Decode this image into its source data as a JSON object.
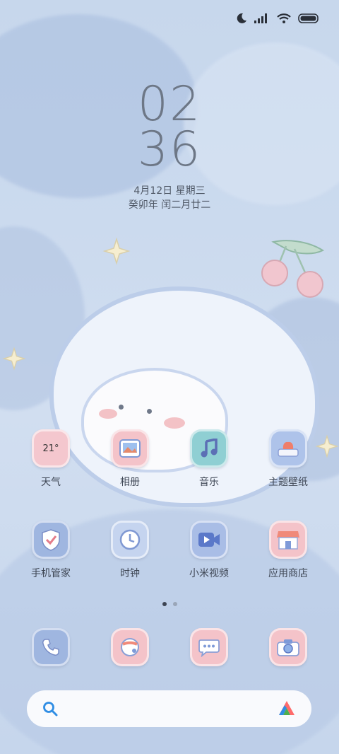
{
  "clock": {
    "hours": "02",
    "minutes": "36"
  },
  "date": {
    "line1": "4月12日 星期三",
    "line2": "癸卯年 闰二月廿二"
  },
  "status_icons": [
    "moon-icon",
    "signal-icon",
    "wifi-icon",
    "battery-icon"
  ],
  "apps_row1": [
    {
      "label": "天气",
      "icon": "weather-icon",
      "temp": "21°",
      "color": "#f4c7ce"
    },
    {
      "label": "相册",
      "icon": "gallery-icon",
      "color": "#f4c3c9"
    },
    {
      "label": "音乐",
      "icon": "music-icon",
      "color": "#8fcfd3"
    },
    {
      "label": "主题壁纸",
      "icon": "theme-icon",
      "color": "#aec3ea"
    }
  ],
  "apps_row2": [
    {
      "label": "手机管家",
      "icon": "shield-icon",
      "color": "#9fb6e0"
    },
    {
      "label": "时钟",
      "icon": "clock-icon",
      "color": "#c5d4ef"
    },
    {
      "label": "小米视频",
      "icon": "video-icon",
      "color": "#a9bde6"
    },
    {
      "label": "应用商店",
      "icon": "store-icon",
      "color": "#f4c3c9"
    }
  ],
  "dock": [
    {
      "icon": "phone-icon",
      "color": "#9fb6e0"
    },
    {
      "icon": "browser-icon",
      "color": "#f4c3c9"
    },
    {
      "icon": "messages-icon",
      "color": "#f4c3c9"
    },
    {
      "icon": "camera-icon",
      "color": "#f4c3c9"
    }
  ],
  "search": {
    "left_icon": "search-icon",
    "right_icon": "assistant-icon"
  },
  "page_indicator": {
    "pages": 2,
    "current": 1
  }
}
